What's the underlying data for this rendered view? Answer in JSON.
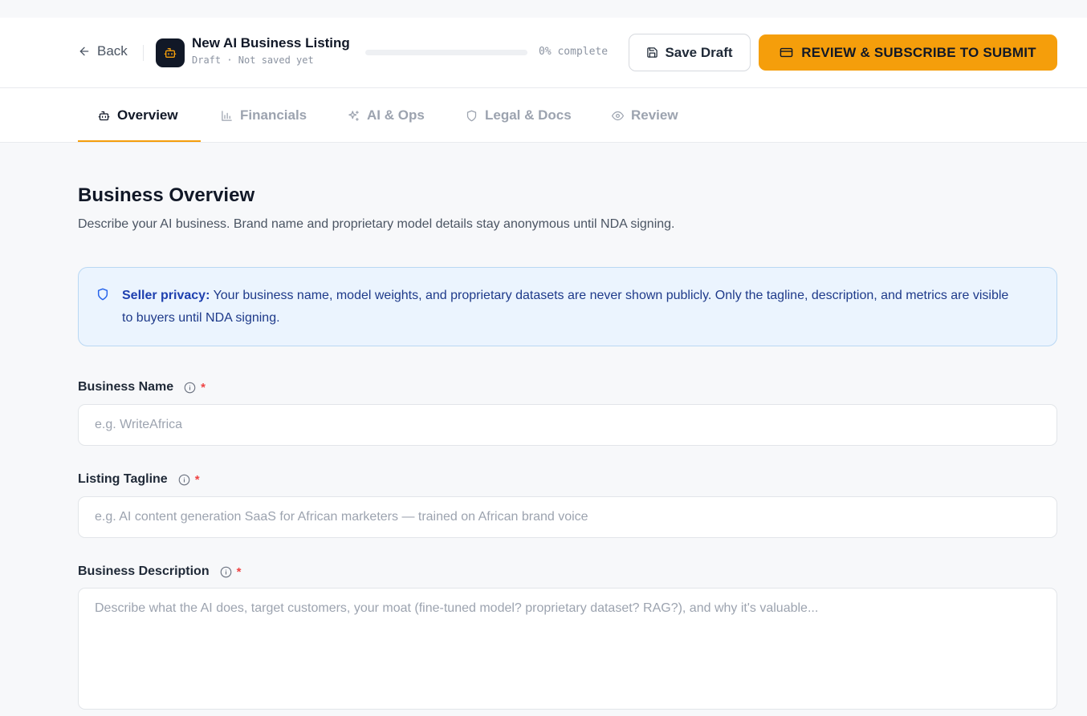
{
  "header": {
    "back_label": "Back",
    "title": "New AI Business Listing",
    "subtitle": "Draft · Not saved yet",
    "progress_text": "0% complete",
    "progress_percent": 0,
    "save_draft_label": "Save Draft",
    "submit_label": "REVIEW & SUBSCRIBE TO SUBMIT",
    "accent_color": "#f59e0b"
  },
  "tabs": [
    {
      "label": "Overview",
      "icon": "bot-icon",
      "active": true
    },
    {
      "label": "Financials",
      "icon": "bar-chart-icon",
      "active": false
    },
    {
      "label": "AI & Ops",
      "icon": "sparkles-icon",
      "active": false
    },
    {
      "label": "Legal & Docs",
      "icon": "shield-icon",
      "active": false
    },
    {
      "label": "Review",
      "icon": "eye-icon",
      "active": false
    }
  ],
  "main": {
    "title": "Business Overview",
    "description": "Describe your AI business. Brand name and proprietary model details stay anonymous until NDA signing.",
    "notice": {
      "bold": "Seller privacy:",
      "text": " Your business name, model weights, and proprietary datasets are never shown publicly. Only the tagline, description, and metrics are visible to buyers until NDA signing."
    },
    "fields": {
      "business_name": {
        "label": "Business Name",
        "required_mark": "*",
        "placeholder": "e.g. WriteAfrica",
        "value": ""
      },
      "tagline": {
        "label": "Listing Tagline",
        "required_mark": "*",
        "placeholder": "e.g. AI content generation SaaS for African marketers — trained on African brand voice",
        "value": ""
      },
      "description": {
        "label": "Business Description",
        "required_mark": "*",
        "placeholder": "Describe what the AI does, target customers, your moat (fine-tuned model? proprietary dataset? RAG?), and why it's valuable...",
        "value": ""
      }
    }
  }
}
